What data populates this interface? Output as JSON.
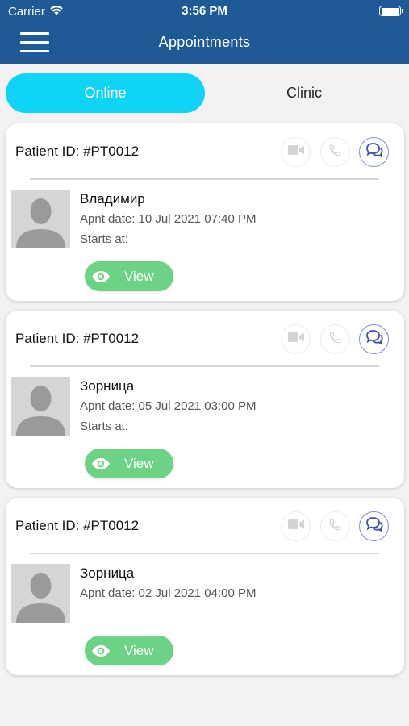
{
  "status_bar": {
    "carrier": "Carrier",
    "time": "3:56 PM"
  },
  "header": {
    "title": "Appointments"
  },
  "tabs": [
    {
      "label": "Online",
      "active": true
    },
    {
      "label": "Clinic",
      "active": false
    }
  ],
  "appointments": [
    {
      "patient_id": "Patient ID: #PT0012",
      "name": "Владимир",
      "apnt_date": "Apnt date: 10 Jul 2021 07:40 PM",
      "starts_at": "Starts at:",
      "view_label": "View"
    },
    {
      "patient_id": "Patient ID: #PT0012",
      "name": "Зорница",
      "apnt_date": "Apnt date: 05 Jul 2021 03:00 PM",
      "starts_at": "Starts at:",
      "view_label": "View"
    },
    {
      "patient_id": "Patient ID: #PT0012",
      "name": "Зорница",
      "apnt_date": "Apnt date: 02 Jul 2021 04:00 PM",
      "starts_at": "",
      "view_label": "View"
    }
  ],
  "icons": {
    "menu": "hamburger-menu-icon",
    "wifi": "wifi-icon",
    "battery": "battery-icon",
    "video": "video-camera-icon",
    "call": "phone-icon",
    "chat": "chat-bubbles-icon",
    "view": "eye-icon",
    "avatar": "person-silhouette-icon"
  },
  "colors": {
    "header_bg": "#1f5a96",
    "tab_active": "#0fd4f5",
    "view_button": "#6dd286",
    "chat_icon": "#3f4fa8",
    "disabled_icon": "#d4d4d4"
  }
}
